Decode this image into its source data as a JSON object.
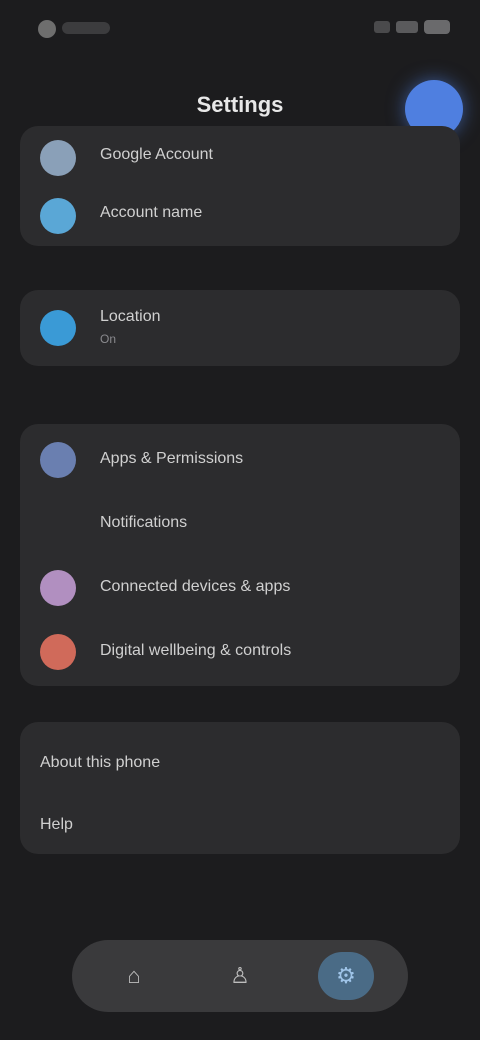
{
  "status_bar": {
    "left_icon": "app-icon",
    "right_icons": [
      "signal-icon",
      "wifi-icon",
      "battery-icon"
    ]
  },
  "header": {
    "title": "Settings",
    "avatar_color": "#4f7fe0"
  },
  "account_card": {
    "profile_label": "Google Account",
    "profile_icon_color": "#8aa0b8",
    "account_name": "Account name",
    "account_icon_color": "#5aa7d6"
  },
  "single_card": {
    "label": "Location",
    "sub": "On",
    "icon_color": "#3a9ad6"
  },
  "section_header": "",
  "settings_list": [
    {
      "label": "Apps & Permissions",
      "sub": "",
      "icon_color": "#6a7fb0"
    },
    {
      "label": "Notifications",
      "sub": "",
      "icon_color": ""
    },
    {
      "label": "Connected devices & apps",
      "sub": "",
      "icon_color": "#b18fc0"
    },
    {
      "label": "Digital wellbeing & controls",
      "sub": "",
      "icon_color": "#d06a5a"
    }
  ],
  "bottom_card": {
    "title": "About this phone",
    "value": "Help"
  },
  "bottom_caption": "",
  "bottom_nav": {
    "items": [
      {
        "name": "home",
        "glyph": "⌂"
      },
      {
        "name": "person",
        "glyph": "♙"
      },
      {
        "name": "settings",
        "glyph": "⚙"
      }
    ],
    "active_color": "#4a6b86"
  }
}
